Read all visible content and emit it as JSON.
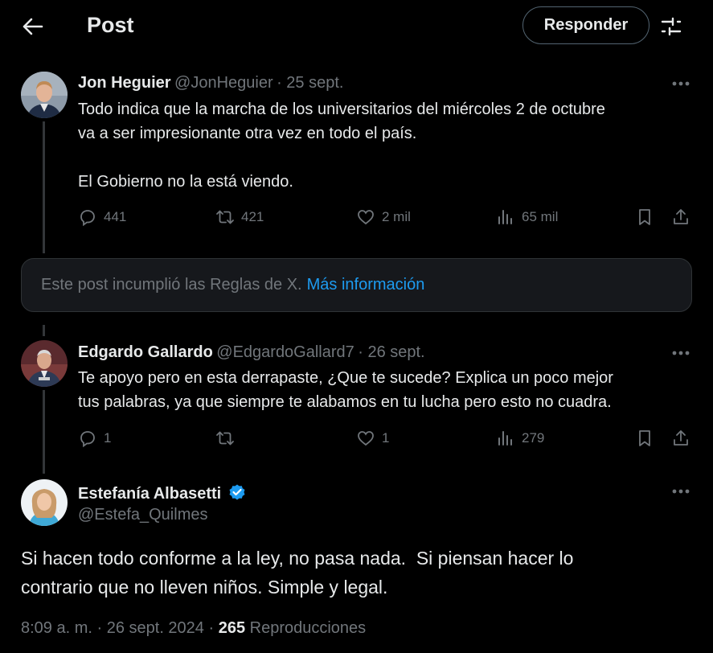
{
  "header": {
    "title": "Post",
    "reply_label": "Responder"
  },
  "parent": {
    "name": "Jon Heguier",
    "handle": "@JonHeguier",
    "date": "· 25 sept.",
    "text_line1": "Todo indica que la marcha de los universitarios del miércoles 2 de octubre",
    "text_line2": "va a ser impresionante otra vez en todo el país.",
    "text_line3": "El Gobierno no la está viendo.",
    "replies": "441",
    "reposts": "421",
    "likes": "2 mil",
    "views": "65 mil"
  },
  "notice": {
    "text": "Este post incumplió las Reglas de X.",
    "link": "Más información"
  },
  "reply": {
    "name": "Edgardo Gallardo",
    "handle": "@EdgardoGallard7",
    "date": "· 26 sept.",
    "text_line1": "Te apoyo pero en esta derrapaste, ¿Que te sucede? Explica un poco mejor",
    "text_line2": "tus palabras, ya que siempre te alabamos en tu lucha pero esto no cuadra.",
    "replies": "1",
    "likes": "1",
    "views": "279"
  },
  "main": {
    "name": "Estefanía Albasetti",
    "handle": "@Estefa_Quilmes",
    "text_line1": "Si hacen todo conforme a la ley, no pasa nada.  Si piensan hacer lo",
    "text_line2": "contrario que no lleven niños. Simple y legal.",
    "time": "8:09 a. m. · 26 sept. 2024 ·",
    "views_count": "265",
    "views_label": "Reproducciones"
  },
  "colors": {
    "background": "#000000",
    "text": "#e7e9ea",
    "muted": "#71767b",
    "link": "#1d9bf0",
    "verified": "#1d9bf0"
  },
  "icons": [
    "back-arrow-icon",
    "tune-icon",
    "more-icon",
    "reply-icon",
    "repost-icon",
    "like-icon",
    "views-icon",
    "bookmark-icon",
    "share-icon",
    "verified-icon"
  ]
}
